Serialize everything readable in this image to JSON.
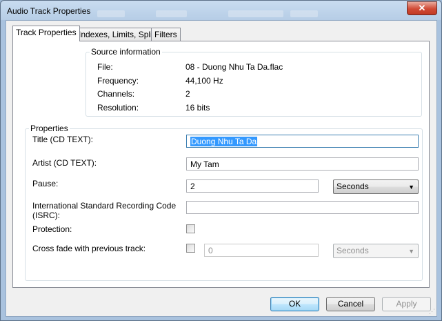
{
  "window": {
    "title": "Audio Track Properties",
    "close_glyph": "✕"
  },
  "tabs": [
    {
      "label": "Track Properties"
    },
    {
      "label": "Indexes, Limits, Split"
    },
    {
      "label": "Filters"
    }
  ],
  "source": {
    "title": "Source information",
    "rows": [
      {
        "label": "File:",
        "value": "08 - Duong Nhu Ta Da.flac"
      },
      {
        "label": "Frequency:",
        "value": "44,100 Hz"
      },
      {
        "label": "Channels:",
        "value": "2"
      },
      {
        "label": "Resolution:",
        "value": "16 bits"
      }
    ]
  },
  "properties": {
    "title": "Properties",
    "title_label": "Title (CD TEXT):",
    "title_value": "Duong Nhu Ta Da",
    "artist_label": "Artist (CD TEXT):",
    "artist_value": "My Tam",
    "pause_label": "Pause:",
    "pause_value": "2",
    "pause_unit": "Seconds",
    "isrc_label_line1": "International Standard Recording Code",
    "isrc_label_line2": "(ISRC):",
    "isrc_value": "",
    "protection_label": "Protection:",
    "protection_checked": false,
    "crossfade_label": "Cross fade with previous track:",
    "crossfade_checked": false,
    "crossfade_value": "0",
    "crossfade_unit": "Seconds"
  },
  "buttons": {
    "ok": "OK",
    "cancel": "Cancel",
    "apply": "Apply"
  },
  "colors": {
    "selection": "#3399ff",
    "focus_border": "#3c7fb1",
    "close_red": "#d04a35"
  }
}
